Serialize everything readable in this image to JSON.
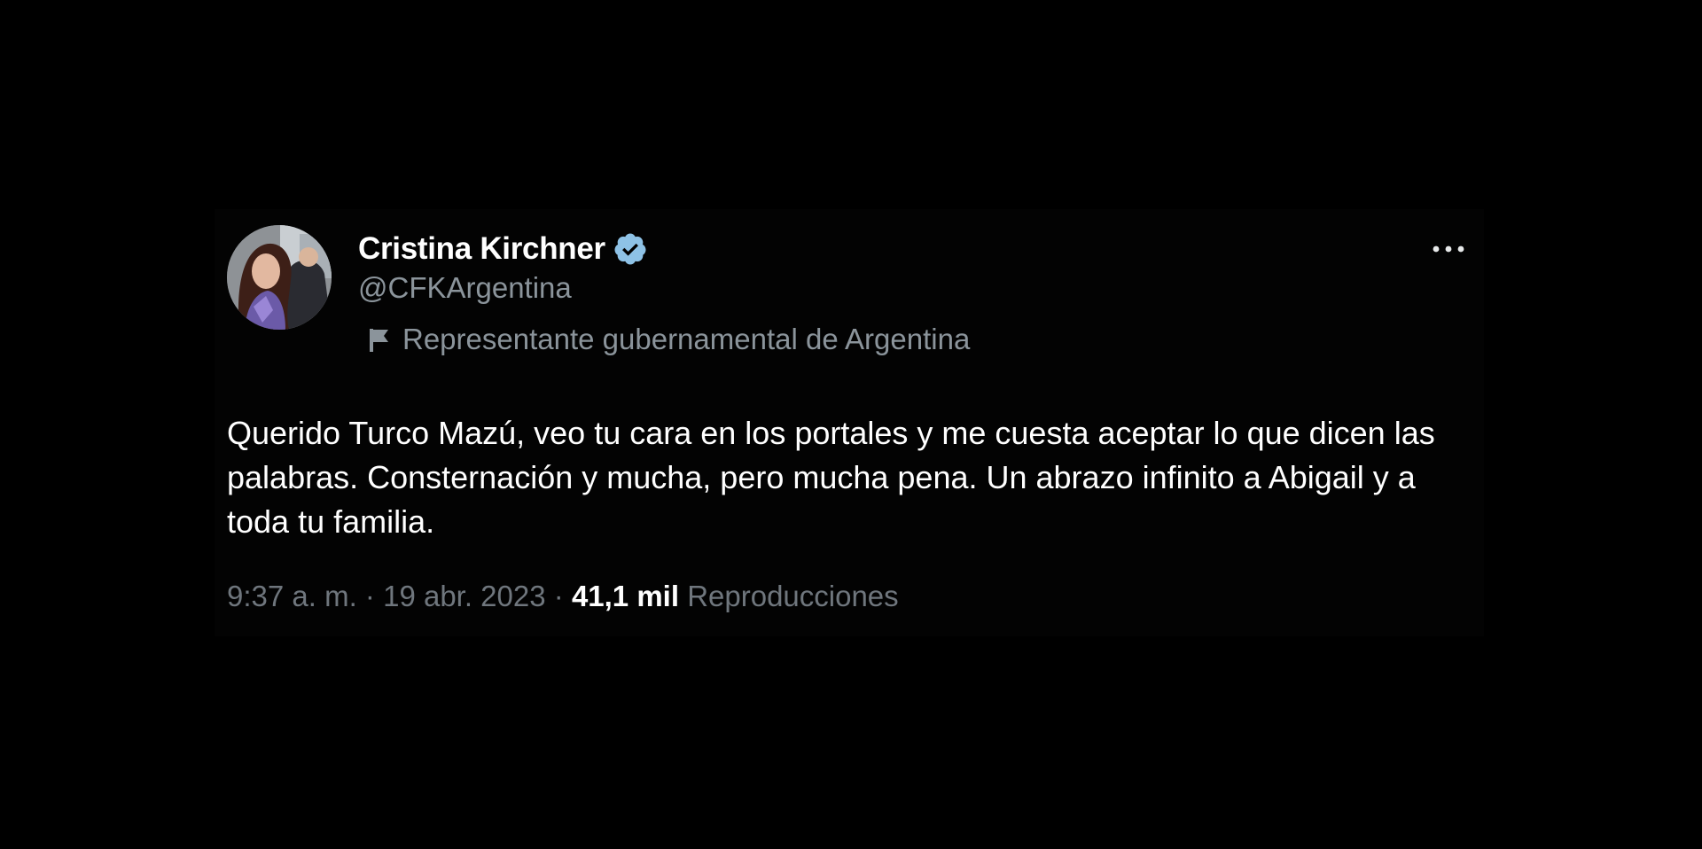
{
  "author": {
    "display_name": "Cristina Kirchner",
    "handle": "@CFKArgentina",
    "verified": true,
    "label": "Representante gubernamental de Argentina",
    "label_icon": "flag-icon",
    "avatar_icon": "profile-photo"
  },
  "tweet": {
    "text": "Querido Turco Mazú, veo tu cara en los portales y me cuesta aceptar lo que dicen las palabras. Consternación y mucha, pero mucha pena. Un abrazo infinito a Abigail y a toda tu familia.",
    "time": "9:37 a. m.",
    "separator": "·",
    "date": "19 abr. 2023",
    "views_count": "41,1 mil",
    "views_label": "Reproducciones"
  },
  "actions": {
    "more_icon": "more-options-icon"
  },
  "colors": {
    "background": "#000000",
    "card": "#030303",
    "text_primary": "#ffffff",
    "text_secondary": "#8b949b",
    "verified_badge": "#8ec2e6"
  }
}
